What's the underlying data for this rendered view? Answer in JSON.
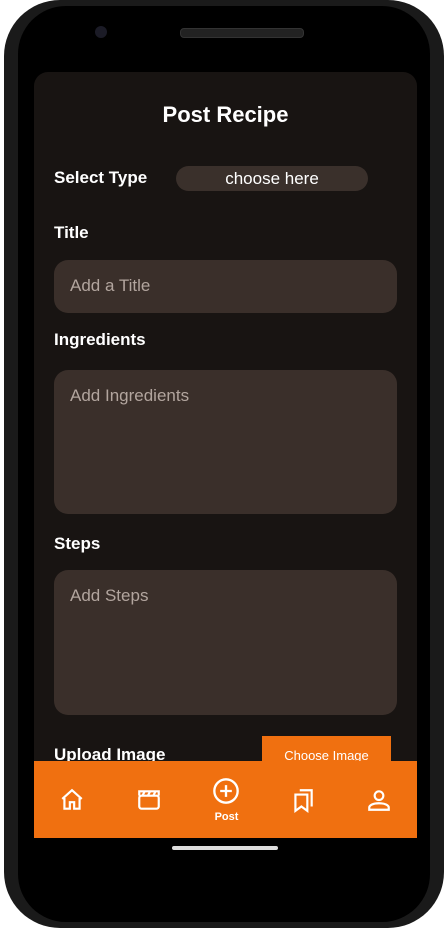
{
  "header": {
    "title": "Post Recipe"
  },
  "form": {
    "select_type_label": "Select Type",
    "select_type_value": "choose here",
    "title_label": "Title",
    "title_placeholder": "Add a Title",
    "ingredients_label": "Ingredients",
    "ingredients_placeholder": "Add Ingredients",
    "steps_label": "Steps",
    "steps_placeholder": "Add Steps",
    "upload_label": "Upload Image",
    "choose_image": "Choose Image"
  },
  "nav": {
    "post_label": "Post"
  },
  "colors": {
    "accent": "#f07010",
    "field_bg": "#3a2f2a"
  }
}
